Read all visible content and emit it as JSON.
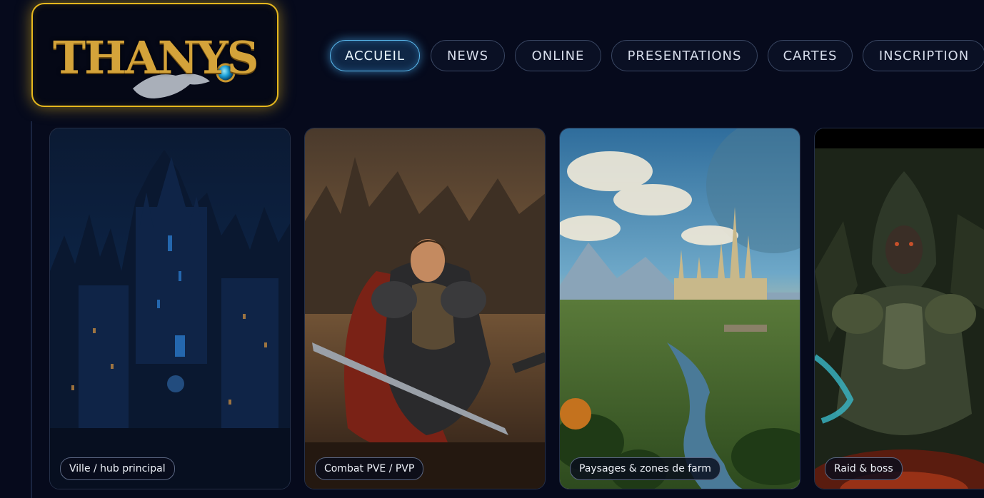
{
  "logo": {
    "text": "THANYS"
  },
  "nav": {
    "items": [
      {
        "label": "ACCUEIL",
        "active": true
      },
      {
        "label": "NEWS",
        "active": false
      },
      {
        "label": "ONLINE",
        "active": false
      },
      {
        "label": "PRESENTATIONS",
        "active": false
      },
      {
        "label": "CARTES",
        "active": false
      },
      {
        "label": "INSCRIPTION",
        "active": false
      }
    ]
  },
  "gallery": {
    "cards": [
      {
        "caption": "Ville / hub principal",
        "image": "dark-gothic-city-image"
      },
      {
        "caption": "Combat PVE / PVP",
        "image": "armored-warrior-image"
      },
      {
        "caption": "Paysages & zones de farm",
        "image": "fantasy-landscape-castle-image"
      },
      {
        "caption": "Raid & boss",
        "image": "dark-armored-boss-image"
      }
    ]
  },
  "colors": {
    "background": "#060a1c",
    "logo_border": "#e7b81e",
    "nav_active_glow": "#5cbcf0",
    "nav_border": "#3a4763"
  }
}
